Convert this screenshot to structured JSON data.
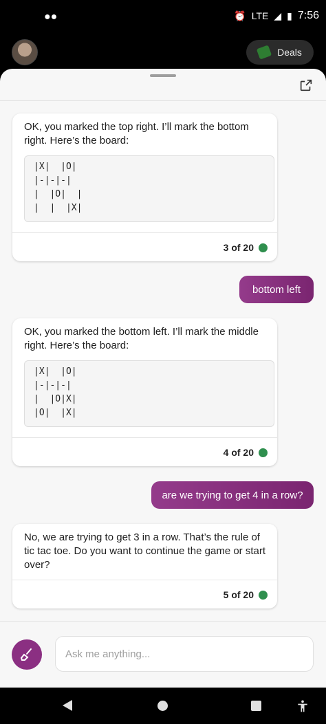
{
  "status": {
    "time": "7:56",
    "network": "LTE",
    "left_icon": "incognito-icon"
  },
  "header": {
    "deals_label": "Deals"
  },
  "messages": [
    {
      "role": "bot",
      "text": "OK, you marked the top right. I’ll mark the bottom right. Here’s the board:",
      "board": [
        "|X|  |O|",
        "|-|-|-|",
        "|  |O|  |",
        "|  |  |X|"
      ],
      "count": "3 of 20"
    },
    {
      "role": "user",
      "text": "bottom left"
    },
    {
      "role": "bot",
      "text": "OK, you marked the bottom left. I’ll mark the middle right. Here’s the board:",
      "board": [
        "|X|  |O|",
        "|-|-|-|",
        "|  |O|X|",
        "|O|  |X|"
      ],
      "count": "4 of 20"
    },
    {
      "role": "user",
      "text": "are we trying to get 4 in a row?"
    },
    {
      "role": "bot",
      "text": "No, we are trying to get 3 in a row. That’s the rule of tic tac toe. Do you want to continue the game or start over?",
      "count": "5 of 20"
    }
  ],
  "composer": {
    "placeholder": "Ask me anything..."
  },
  "colors": {
    "accent": "#8b2f82",
    "status_dot": "#2f8f4e"
  }
}
